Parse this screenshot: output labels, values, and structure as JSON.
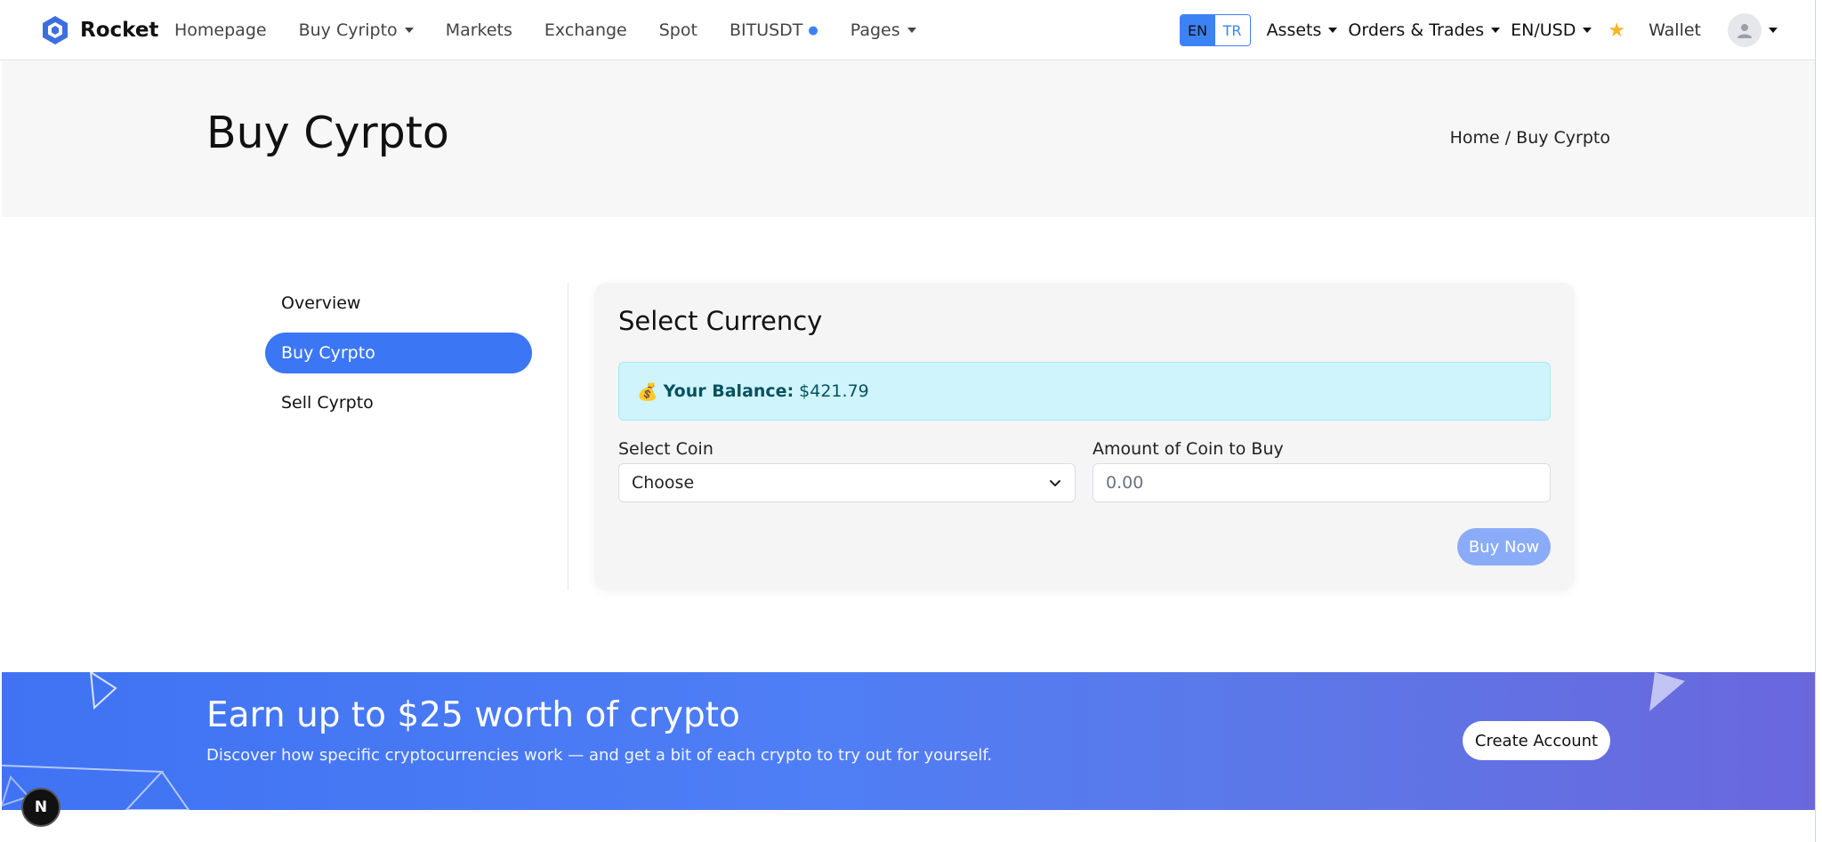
{
  "brand": {
    "name": "Rocket",
    "accent": "#3b82f6"
  },
  "nav": {
    "items": [
      {
        "label": "Homepage"
      },
      {
        "label": "Buy Cyripto",
        "dropdown": true
      },
      {
        "label": "Markets"
      },
      {
        "label": "Exchange"
      },
      {
        "label": "Spot"
      },
      {
        "label": "BITUSDT"
      },
      {
        "label": "Pages",
        "dropdown": true
      }
    ],
    "lang": [
      "EN",
      "TR"
    ],
    "right": {
      "assets": "Assets",
      "orders": "Orders & Trades",
      "currency": "EN/USD",
      "wallet": "Wallet"
    }
  },
  "header": {
    "title": "Buy Cyrpto",
    "breadcrumb": "Home / Buy Cyrpto"
  },
  "sidebar": {
    "items": [
      {
        "label": "Overview",
        "active": false
      },
      {
        "label": "Buy Cyrpto",
        "active": true
      },
      {
        "label": "Sell Cyrpto",
        "active": false
      }
    ]
  },
  "card": {
    "title": "Select Currency",
    "balance_label": "Your Balance:",
    "balance_value": "$421.79",
    "coin_label": "Select Coin",
    "coin_value": "Choose",
    "amount_label": "Amount of Coin to Buy",
    "amount_placeholder": "0.00",
    "buy_button": "Buy Now"
  },
  "promo": {
    "title": "Earn up to $25 worth of crypto",
    "subtitle": "Discover how specific cryptocurrencies work — and get a bit of each crypto to try out for yourself.",
    "button": "Create Account"
  },
  "badge": {
    "letter": "N"
  }
}
